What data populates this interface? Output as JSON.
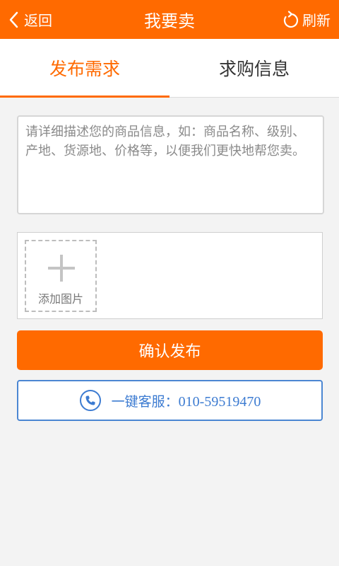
{
  "header": {
    "back_label": "返回",
    "title": "我要卖",
    "refresh_label": "刷新",
    "background": "#ff6a00"
  },
  "tabs": [
    {
      "label": "发布需求",
      "active": true
    },
    {
      "label": "求购信息",
      "active": false
    }
  ],
  "form": {
    "description_placeholder": "请详细描述您的商品信息，如：商品名称、级别、产地、货源地、价格等，以便我们更快地帮您卖。",
    "description_value": "",
    "add_image_label": "添加图片",
    "confirm_label": "确认发布"
  },
  "service": {
    "label": "一键客服：",
    "phone": "010-59519470",
    "icon": "phone-icon",
    "color": "#3c7bd1"
  }
}
